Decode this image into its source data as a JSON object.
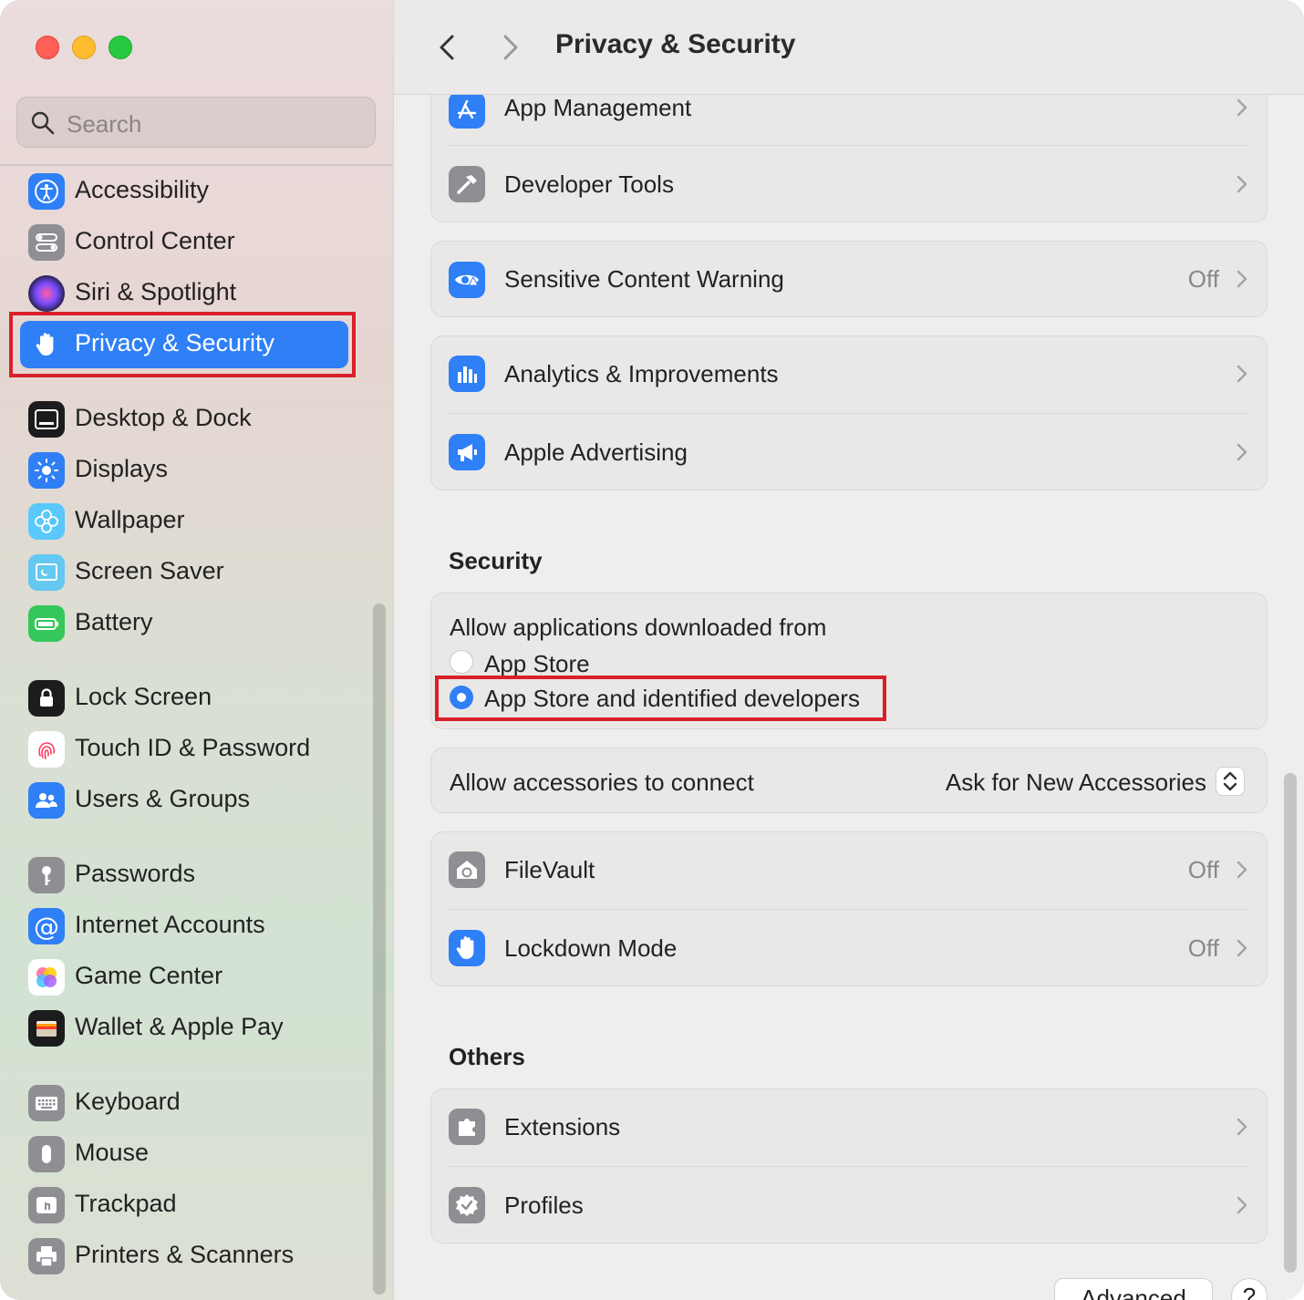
{
  "window": {
    "title": "Privacy & Security"
  },
  "search": {
    "placeholder": "Search"
  },
  "sidebar": {
    "items": [
      {
        "label": "Accessibility",
        "icon": "accessibility-icon"
      },
      {
        "label": "Control Center",
        "icon": "control-center-icon"
      },
      {
        "label": "Siri & Spotlight",
        "icon": "siri-icon"
      },
      {
        "label": "Privacy & Security",
        "icon": "hand-icon",
        "selected": true
      },
      {
        "label": "Desktop & Dock",
        "icon": "dock-icon"
      },
      {
        "label": "Displays",
        "icon": "sun-icon"
      },
      {
        "label": "Wallpaper",
        "icon": "flower-icon"
      },
      {
        "label": "Screen Saver",
        "icon": "screensaver-icon"
      },
      {
        "label": "Battery",
        "icon": "battery-icon"
      },
      {
        "label": "Lock Screen",
        "icon": "lock-icon"
      },
      {
        "label": "Touch ID & Password",
        "icon": "fingerprint-icon"
      },
      {
        "label": "Users & Groups",
        "icon": "users-icon"
      },
      {
        "label": "Passwords",
        "icon": "key-icon"
      },
      {
        "label": "Internet Accounts",
        "icon": "at-icon"
      },
      {
        "label": "Game Center",
        "icon": "game-center-icon"
      },
      {
        "label": "Wallet & Apple Pay",
        "icon": "wallet-icon"
      },
      {
        "label": "Keyboard",
        "icon": "keyboard-icon"
      },
      {
        "label": "Mouse",
        "icon": "mouse-icon"
      },
      {
        "label": "Trackpad",
        "icon": "trackpad-icon"
      },
      {
        "label": "Printers & Scanners",
        "icon": "printer-icon"
      }
    ]
  },
  "main": {
    "rows": {
      "app_management": "App Management",
      "developer_tools": "Developer Tools",
      "sensitive_content": {
        "label": "Sensitive Content Warning",
        "value": "Off"
      },
      "analytics": "Analytics & Improvements",
      "advertising": "Apple Advertising",
      "filevault": {
        "label": "FileVault",
        "value": "Off"
      },
      "lockdown": {
        "label": "Lockdown Mode",
        "value": "Off"
      },
      "extensions": "Extensions",
      "profiles": "Profiles"
    },
    "security": {
      "heading": "Security",
      "allow_label": "Allow applications downloaded from",
      "options": [
        "App Store",
        "App Store and identified developers"
      ],
      "selected_option": "App Store and identified developers",
      "accessories_label": "Allow accessories to connect",
      "accessories_value": "Ask for New Accessories"
    },
    "others_heading": "Others",
    "advanced_button": "Advanced",
    "help_button": "?"
  },
  "colors": {
    "accent": "#2f7ff6",
    "highlight": "#d9202a"
  }
}
